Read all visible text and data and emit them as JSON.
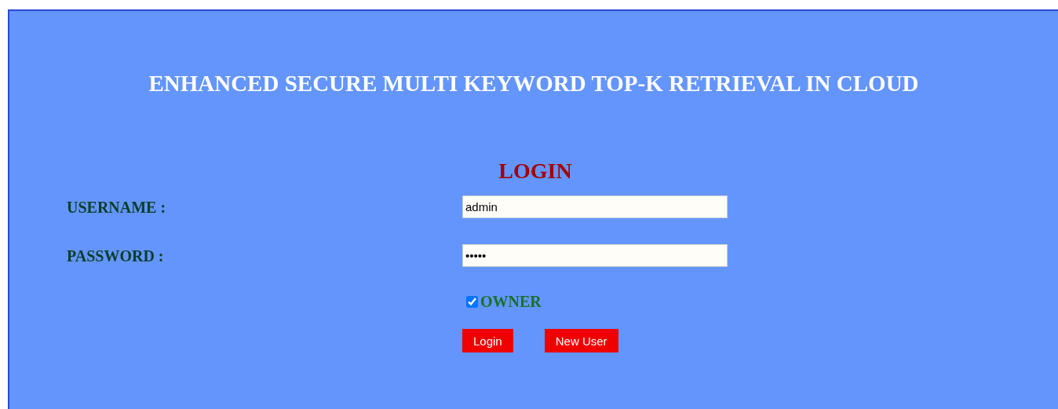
{
  "title": "ENHANCED SECURE MULTI KEYWORD TOP-K RETRIEVAL IN CLOUD",
  "form": {
    "heading": "LOGIN",
    "fields": [
      {
        "label": "USERNAME :",
        "value": "admin"
      },
      {
        "label": "PASSWORD :",
        "value": "•••••"
      }
    ],
    "owner": {
      "label": "OWNER",
      "checked": true
    },
    "buttons": [
      "Login",
      "New User"
    ]
  }
}
